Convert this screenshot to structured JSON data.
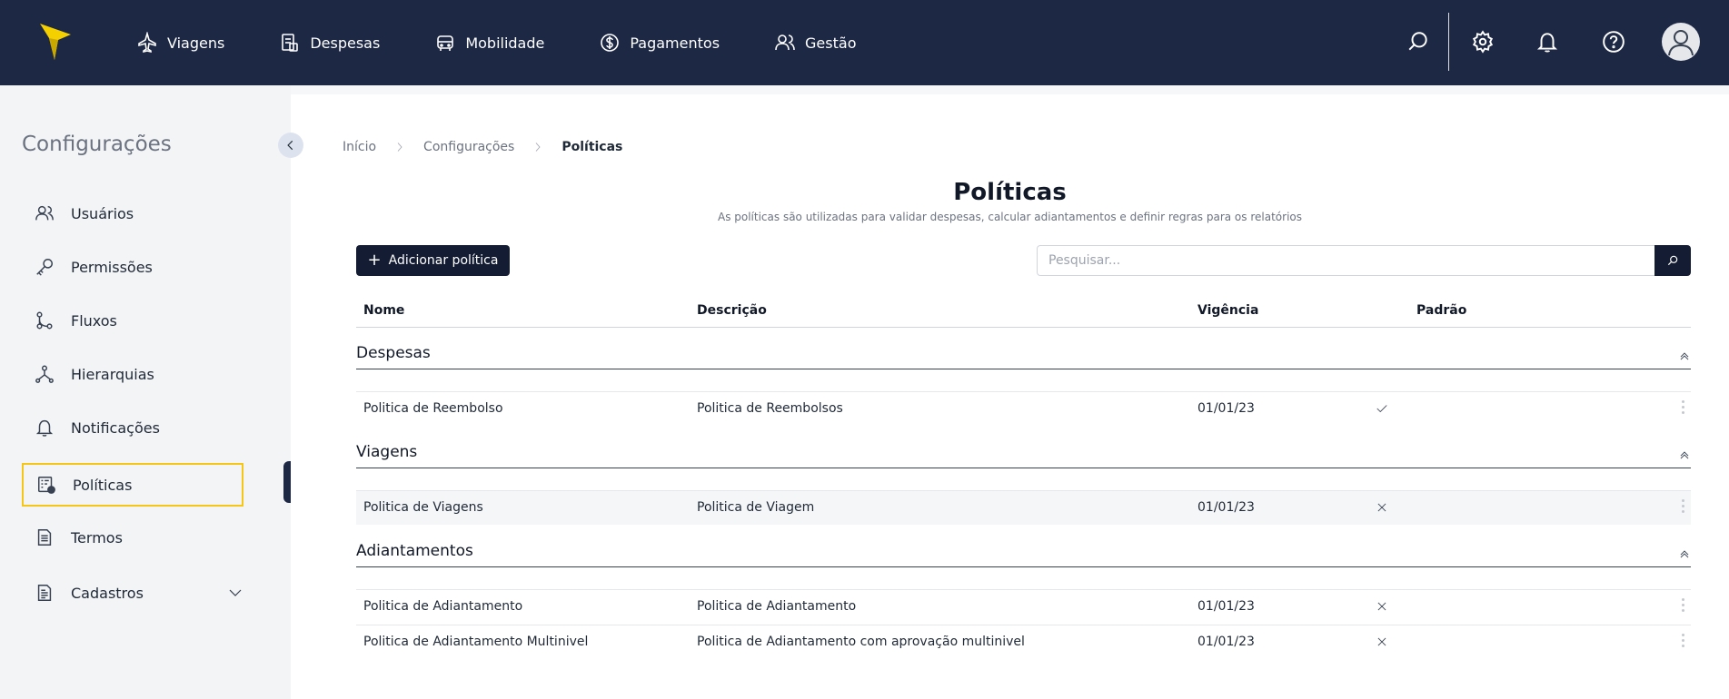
{
  "topbar": {
    "nav": [
      {
        "label": "Viagens",
        "icon": "plane-icon"
      },
      {
        "label": "Despesas",
        "icon": "receipt-icon"
      },
      {
        "label": "Mobilidade",
        "icon": "car-icon"
      },
      {
        "label": "Pagamentos",
        "icon": "dollar-circle-icon"
      },
      {
        "label": "Gestão",
        "icon": "users-icon"
      }
    ],
    "colors": {
      "background": "#1d2845",
      "logo": "#f5d000"
    }
  },
  "sidebar": {
    "title": "Configurações",
    "items": [
      {
        "label": "Usuários",
        "icon": "users-icon"
      },
      {
        "label": "Permissões",
        "icon": "key-icon"
      },
      {
        "label": "Fluxos",
        "icon": "flow-icon"
      },
      {
        "label": "Hierarquias",
        "icon": "hierarchy-icon"
      },
      {
        "label": "Notificações",
        "icon": "bell-icon"
      },
      {
        "label": "Políticas",
        "icon": "policy-icon"
      },
      {
        "label": "Termos",
        "icon": "document-icon"
      },
      {
        "label": "Cadastros",
        "icon": "register-icon"
      }
    ],
    "active_item": "Políticas",
    "active_color": "#f5c518"
  },
  "breadcrumb": {
    "items": [
      "Início",
      "Configurações",
      "Políticas"
    ]
  },
  "page": {
    "title": "Políticas",
    "subtitle": "As políticas são utilizadas para validar despesas, calcular adiantamentos e definir regras para os relatórios"
  },
  "toolbar": {
    "add_label": "Adicionar política",
    "search_placeholder": "Pesquisar..."
  },
  "table": {
    "columns": [
      "Nome",
      "Descrição",
      "Vigência",
      "Padrão"
    ],
    "groups": [
      {
        "name": "Despesas",
        "rows": [
          {
            "nome": "Politica de Reembolso",
            "descricao": "Politica de Reembolsos",
            "vigencia": "01/01/23",
            "padrao": true
          }
        ]
      },
      {
        "name": "Viagens",
        "rows": [
          {
            "nome": "Politica de Viagens",
            "descricao": "Politica de Viagem",
            "vigencia": "01/01/23",
            "padrao": false
          }
        ]
      },
      {
        "name": "Adiantamentos",
        "rows": [
          {
            "nome": "Politica de Adiantamento",
            "descricao": "Politica de Adiantamento",
            "vigencia": "01/01/23",
            "padrao": false
          },
          {
            "nome": "Politica de Adiantamento Multinivel",
            "descricao": "Politica de Adiantamento com aprovação multinivel",
            "vigencia": "01/01/23",
            "padrao": false
          }
        ]
      }
    ]
  }
}
